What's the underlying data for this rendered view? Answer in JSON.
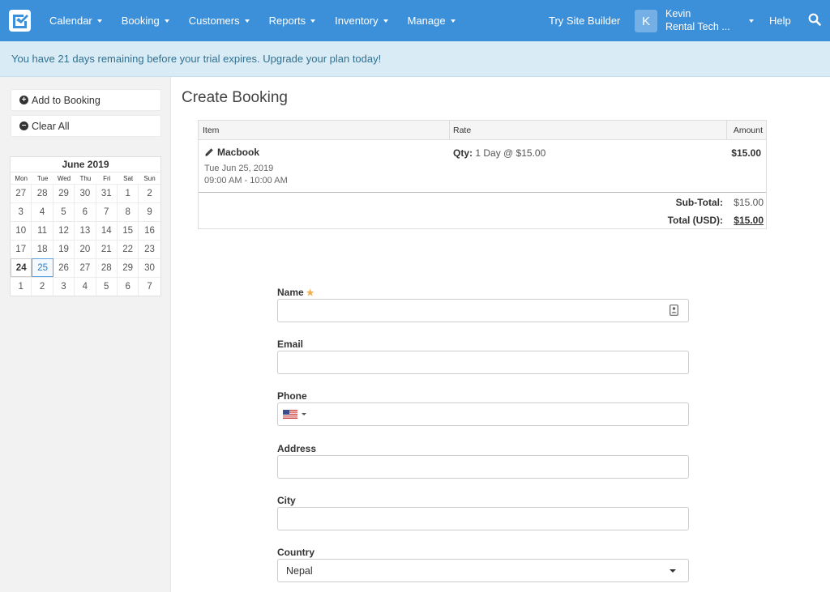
{
  "nav": {
    "items": [
      {
        "label": "Calendar",
        "dropdown": true
      },
      {
        "label": "Booking",
        "dropdown": true
      },
      {
        "label": "Customers",
        "dropdown": true
      },
      {
        "label": "Reports",
        "dropdown": true
      },
      {
        "label": "Inventory",
        "dropdown": true
      },
      {
        "label": "Manage",
        "dropdown": true
      }
    ],
    "site_builder": "Try Site Builder",
    "avatar_letter": "K",
    "user_name": "Kevin",
    "user_company": "Rental Tech ...",
    "help": "Help",
    "icons": {
      "logo": "checkbox-logo-icon",
      "search": "search-icon"
    },
    "colors": {
      "bar": "#3c8fd9"
    }
  },
  "banner": {
    "text": "You have 21 days remaining before your trial expires. Upgrade your plan today!"
  },
  "sidebar": {
    "add_to_booking": "Add to Booking",
    "clear_all": "Clear All",
    "calendar": {
      "title": "June 2019",
      "weekdays": [
        "Mon",
        "Tue",
        "Wed",
        "Thu",
        "Fri",
        "Sat",
        "Sun"
      ],
      "days": [
        "27",
        "28",
        "29",
        "30",
        "31",
        "1",
        "2",
        "3",
        "4",
        "5",
        "6",
        "7",
        "8",
        "9",
        "10",
        "11",
        "12",
        "13",
        "14",
        "15",
        "16",
        "17",
        "18",
        "19",
        "20",
        "21",
        "22",
        "23",
        "24",
        "25",
        "26",
        "27",
        "28",
        "29",
        "30",
        "1",
        "2",
        "3",
        "4",
        "5",
        "6",
        "7"
      ],
      "today": "24",
      "selected": "25"
    }
  },
  "main": {
    "title": "Create Booking",
    "table": {
      "headers": {
        "item": "Item",
        "rate": "Rate",
        "amount": "Amount"
      },
      "row": {
        "item_name": "Macbook",
        "date": "Tue Jun 25, 2019",
        "time": "09:00 AM - 10:00 AM",
        "qty_label": "Qty:",
        "qty_value": "1 Day @ $15.00",
        "amount": "$15.00"
      },
      "subtotal_label": "Sub-Total:",
      "subtotal_value": "$15.00",
      "total_label": "Total (USD):",
      "total_value": "$15.00"
    },
    "form": {
      "name_label": "Name",
      "required_mark": "★",
      "email_label": "Email",
      "phone_label": "Phone",
      "address_label": "Address",
      "city_label": "City",
      "country_label": "Country",
      "country_value": "Nepal"
    }
  }
}
